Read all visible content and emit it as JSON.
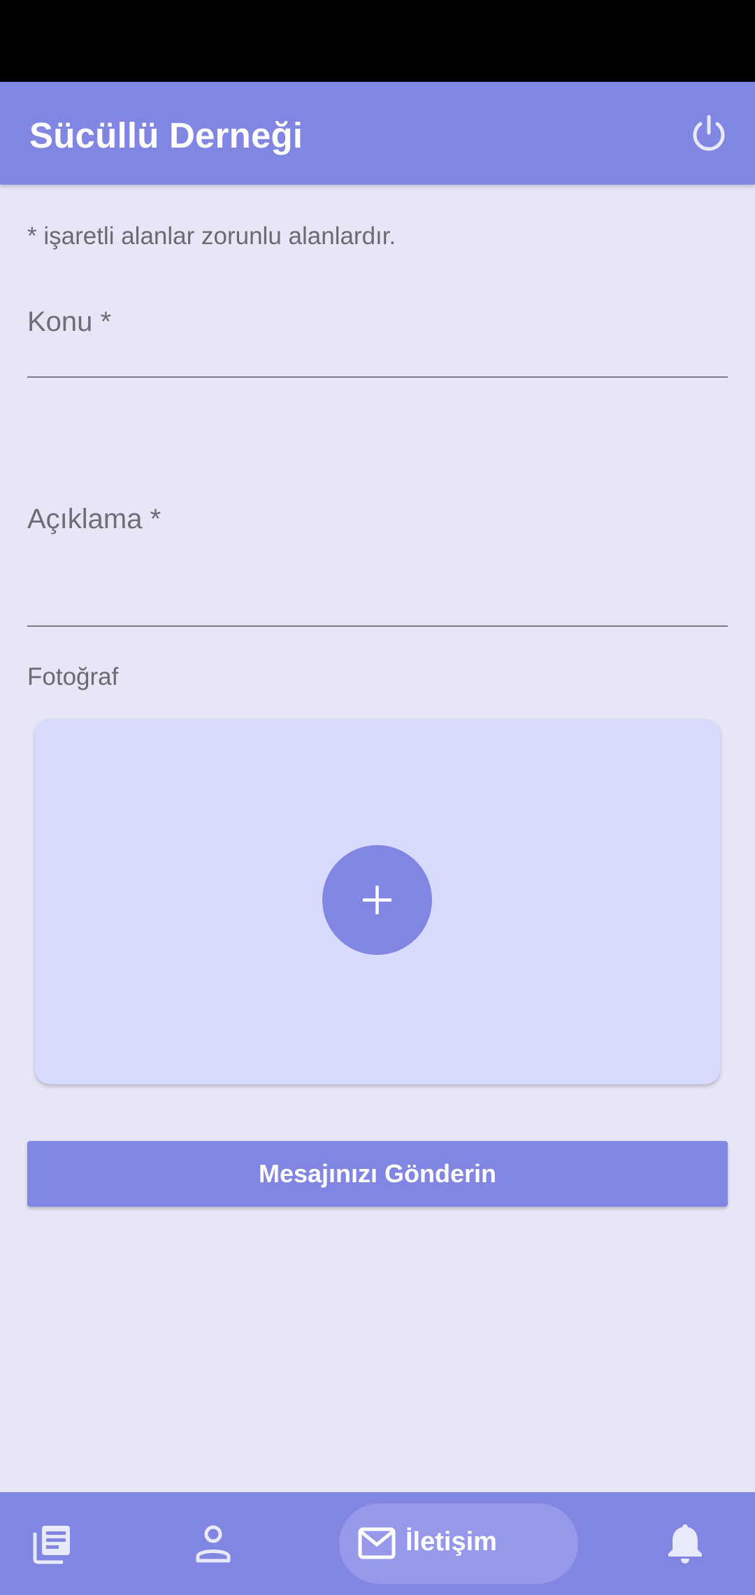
{
  "app_bar": {
    "title": "Sücüllü Derneği",
    "power_icon": "power-icon"
  },
  "form": {
    "required_hint": "* işaretli alanlar zorunlu alanlardır.",
    "subject_label": "Konu *",
    "description_label": "Açıklama *",
    "photo_label": "Fotoğraf",
    "add_photo_icon": "plus-icon",
    "submit_label": "Mesajınızı Gönderin"
  },
  "bottom_nav": {
    "items": [
      {
        "icon": "news-icon",
        "label": ""
      },
      {
        "icon": "person-icon",
        "label": ""
      },
      {
        "icon": "mail-icon",
        "label": "İletişim",
        "selected": true
      },
      {
        "icon": "bell-icon",
        "label": ""
      }
    ]
  },
  "colors": {
    "primary": "#8086e2",
    "background": "#e6e6f7",
    "photo_card": "#d8dafe",
    "selected_nav_pill": "#9699e9"
  }
}
